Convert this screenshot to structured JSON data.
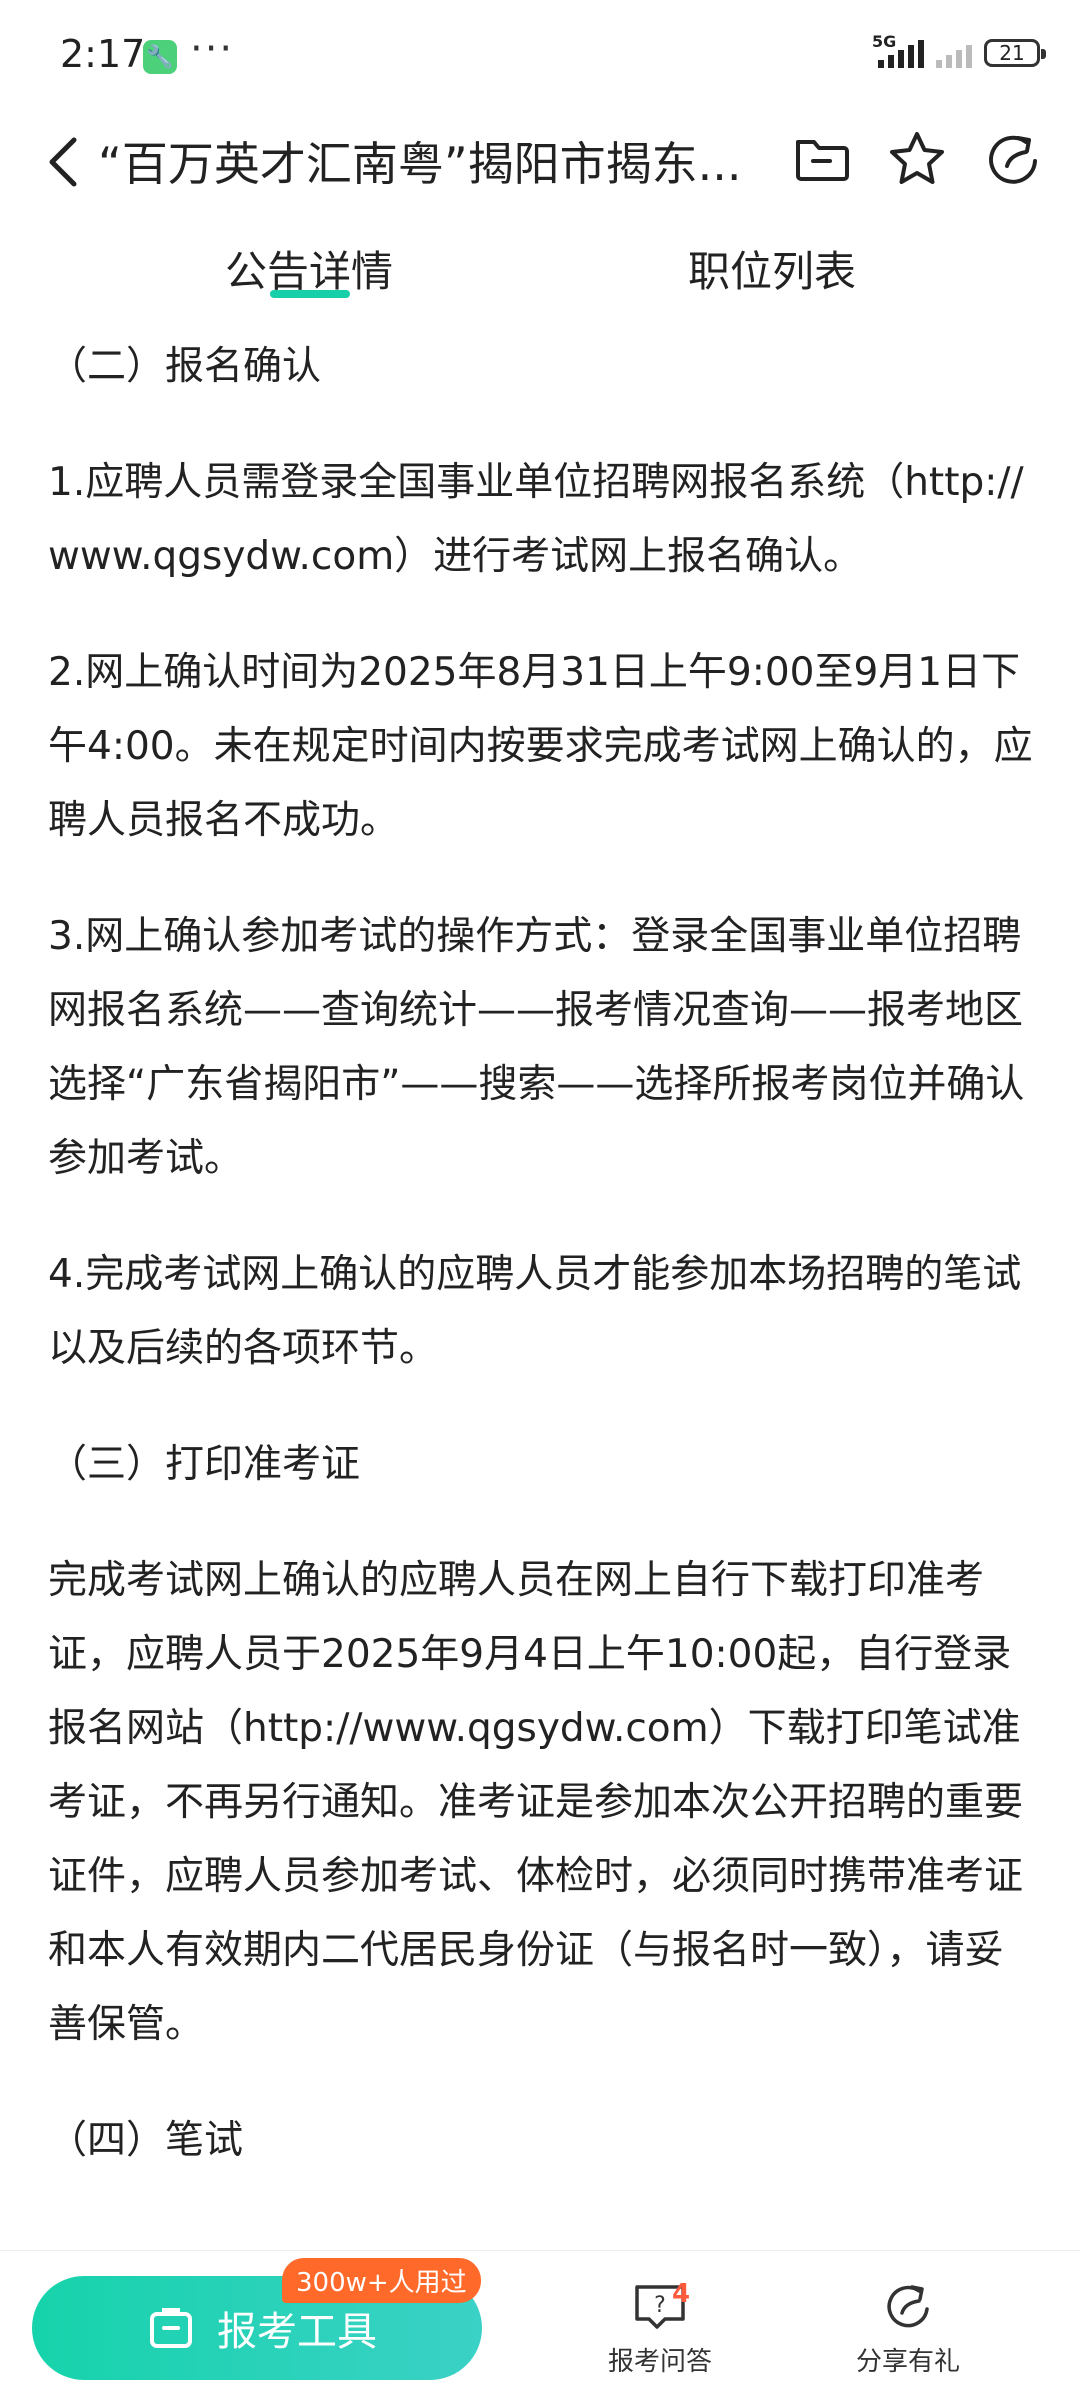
{
  "status": {
    "time": "2:17",
    "more": "···",
    "network": "5G",
    "battery": "21"
  },
  "nav": {
    "title": "“百万英才汇南粤”揭阳市揭东...",
    "back_icon": "chevron-left-icon",
    "folder_icon": "folder-icon",
    "star_icon": "star-icon",
    "share_icon": "share-icon"
  },
  "tabs": [
    {
      "label": "公告详情",
      "active": true
    },
    {
      "label": "职位列表",
      "active": false
    }
  ],
  "content": {
    "paragraphs": [
      "（二）报名确认",
      "1.应聘人员需登录全国事业单位招聘网报名系统（http://www.qgsydw.com）进行考试网上报名确认。",
      "2.网上确认时间为2025年8月31日上午9:00至9月1日下午4:00。未在规定时间内按要求完成考试网上确认的，应聘人员报名不成功。",
      "3.网上确认参加考试的操作方式：登录全国事业单位招聘网报名系统——查询统计——报考情况查询——报考地区选择“广东省揭阳市”——搜索——选择所报考岗位并确认参加考试。",
      "4.完成考试网上确认的应聘人员才能参加本场招聘的笔试以及后续的各项环节。",
      "（三）打印准考证",
      "完成考试网上确认的应聘人员在网上自行下载打印准考证，应聘人员于2025年9月4日上午10:00起，自行登录报名网站（http://www.qgsydw.com）下载打印笔试准考证，不再另行通知。准考证是参加本次公开招聘的重要证件，应聘人员参加考试、体检时，必须同时携带准考证和本人有效期内二代居民身份证（与报名时一致），请妥善保管。",
      "（四）笔试"
    ]
  },
  "bottom": {
    "tool_label": "报考工具",
    "tool_badge": "300w+人用过",
    "qa_label": "报考问答",
    "qa_count": "4",
    "share_label": "分享有礼"
  },
  "colors": {
    "accent": "#17cfa9",
    "badge": "#ff6a2b"
  }
}
